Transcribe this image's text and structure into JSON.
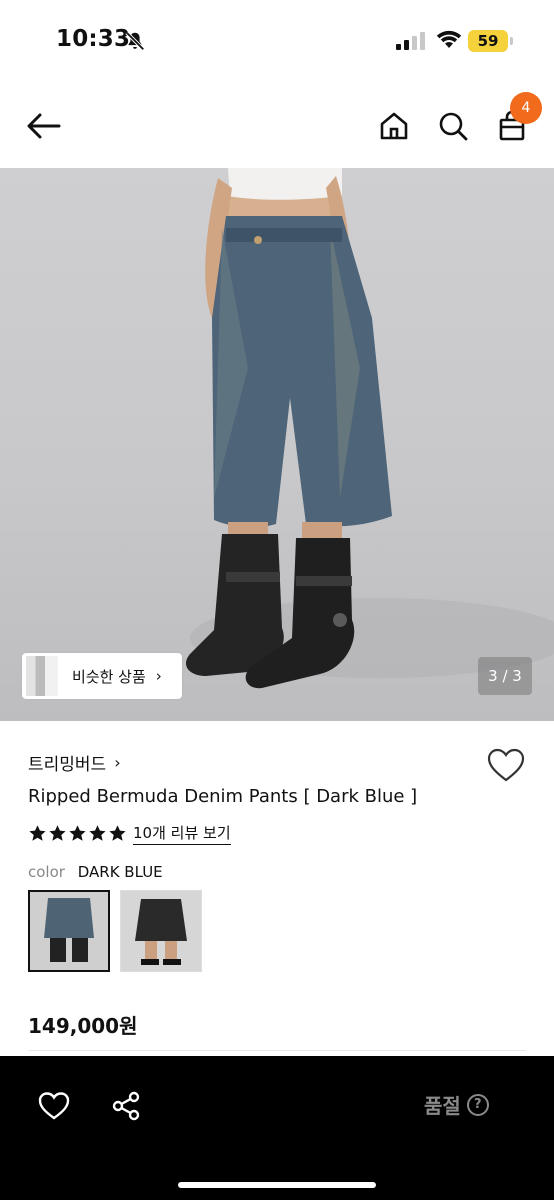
{
  "status": {
    "time": "10:33",
    "battery": "59",
    "icons": [
      "bell-off-icon",
      "signal-icon",
      "wifi-icon",
      "battery-icon"
    ]
  },
  "nav": {
    "cart_count": "4",
    "icons": [
      "back-arrow-icon",
      "home-icon",
      "search-icon",
      "bag-icon"
    ]
  },
  "hero": {
    "similar_label": "비슷한 상품",
    "page_indicator": "3 / 3"
  },
  "product": {
    "brand": "트리밍버드",
    "name": "Ripped Bermuda Denim Pants [ Dark Blue ]",
    "rating_stars": 5,
    "review_link": "10개 리뷰 보기",
    "color_key": "color",
    "color_value": "DARK BLUE",
    "swatches": [
      "dark-blue",
      "black"
    ],
    "price": "149,000원"
  },
  "bottom": {
    "soldout_label": "품절",
    "help": "?",
    "icons": [
      "heart-icon",
      "share-icon",
      "help-icon"
    ]
  },
  "colors": {
    "accent": "#f26a1b",
    "battery": "#f5d23c",
    "bottom_bar": "#000000",
    "soldout_text": "#8a8a8a"
  }
}
